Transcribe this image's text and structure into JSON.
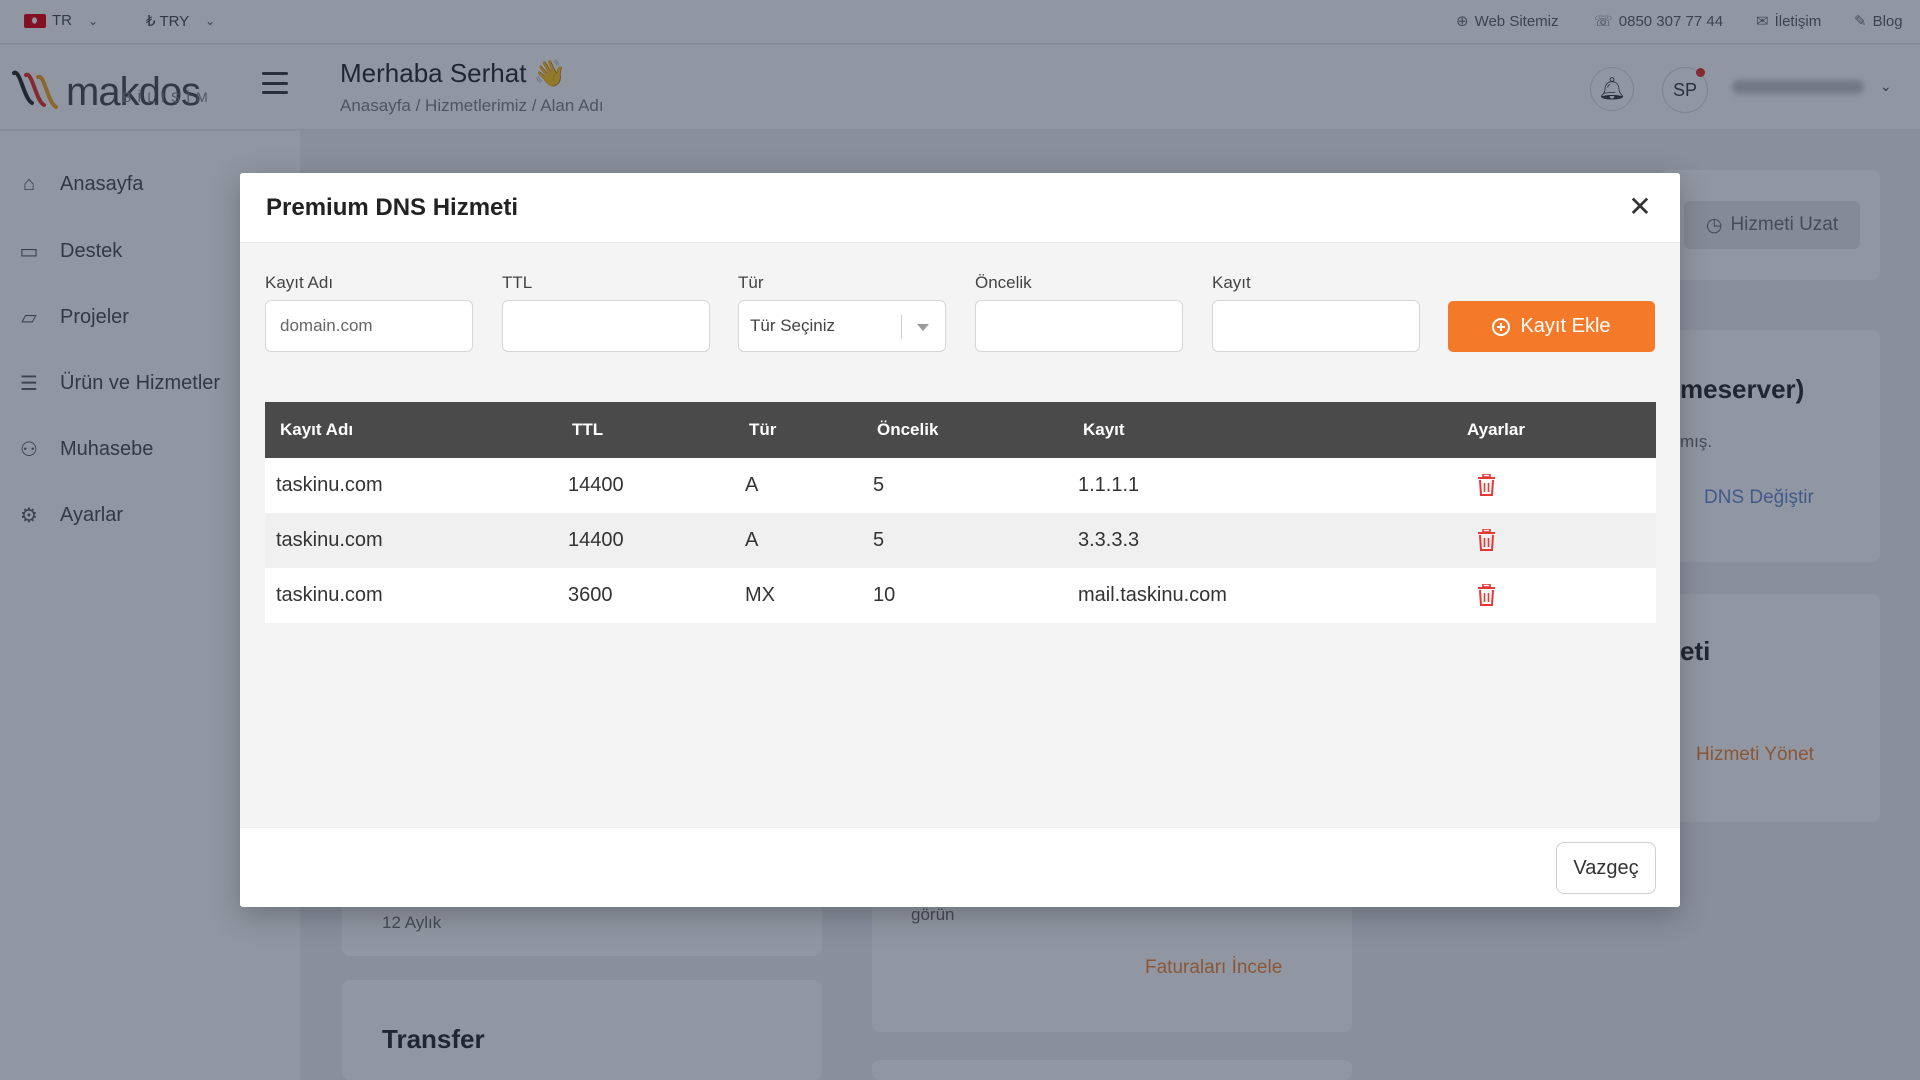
{
  "topbar": {
    "language": "TR",
    "currency": "₺ TRY",
    "links": [
      "Web Sitemiz",
      "0850 307 77 44",
      "İletişim",
      "Blog"
    ]
  },
  "header": {
    "logo_text": "makdos",
    "logo_sub": "BİLİŞİM",
    "greeting": "Merhaba Serhat 👋",
    "breadcrumb": "Anasayfa / Hizmetlerimiz / Alan Adı",
    "avatar_initials": "SP"
  },
  "sidebar": {
    "items": [
      {
        "label": "Anasayfa",
        "icon": "home-icon"
      },
      {
        "label": "Destek",
        "icon": "chat-icon"
      },
      {
        "label": "Projeler",
        "icon": "folder-icon"
      },
      {
        "label": "Ürün ve Hizmetler",
        "icon": "list-icon"
      },
      {
        "label": "Muhasebe",
        "icon": "users-icon"
      },
      {
        "label": "Ayarlar",
        "icon": "gear-icon"
      }
    ]
  },
  "background": {
    "renew_button": "Hizmeti Uzat",
    "nameserver_heading": "meserver)",
    "nameserver_sub": "mış.",
    "dns_change_link": "DNS Değiştir",
    "service_heading": "eti",
    "manage_service_link": "Hizmeti Yönet",
    "period_text": "12 Aylık",
    "invoice_sub": "görün",
    "invoice_link": "Faturaları İncele",
    "transfer_heading": "Transfer"
  },
  "modal": {
    "title": "Premium DNS Hizmeti",
    "form": {
      "labels": [
        "Kayıt Adı",
        "TTL",
        "Tür",
        "Öncelik",
        "Kayıt"
      ],
      "name_placeholder": "domain.com",
      "type_selected": "Tür Seçiniz",
      "add_button": "Kayıt Ekle"
    },
    "table": {
      "headers": [
        "Kayıt Adı",
        "TTL",
        "Tür",
        "Öncelik",
        "Kayıt",
        "Ayarlar"
      ],
      "rows": [
        [
          "taskinu.com",
          "14400",
          "A",
          "5",
          "1.1.1.1"
        ],
        [
          "taskinu.com",
          "14400",
          "A",
          "5",
          "3.3.3.3"
        ],
        [
          "taskinu.com",
          "3600",
          "MX",
          "10",
          "mail.taskinu.com"
        ]
      ]
    },
    "cancel_button": "Vazgeç"
  },
  "colors": {
    "accent": "#f47a2a",
    "table_header": "#4a4a4a",
    "danger": "#e53935",
    "overlay": "#0a1830"
  }
}
